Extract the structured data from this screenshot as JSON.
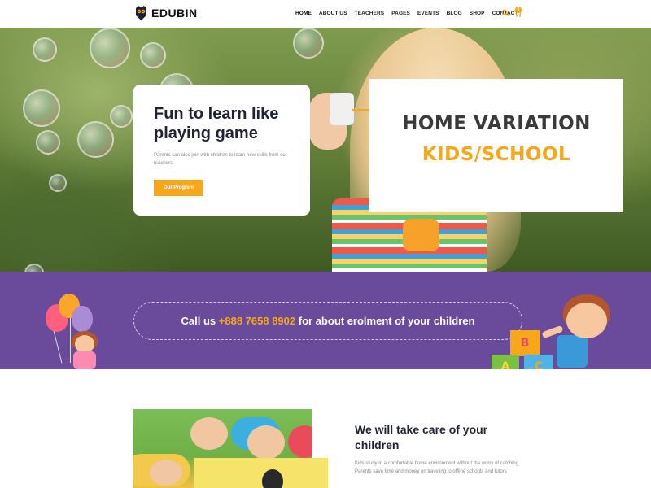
{
  "brand": {
    "name": "EDUBIN"
  },
  "nav": {
    "items": [
      "HOME",
      "ABOUT US",
      "TEACHERS",
      "PAGES",
      "EVENTS",
      "BLOG",
      "SHOP",
      "CONTACT"
    ],
    "cart_count": "0",
    "icons": [
      "search-icon",
      "cart-icon"
    ]
  },
  "hero": {
    "title": "Fun to learn like playing game",
    "text": "Parents can also join with children to learn new skills from our teachers",
    "button": "Our Program"
  },
  "variation": {
    "title": "HOME VARIATION",
    "subtitle": "KIDS/SCHOOL"
  },
  "call": {
    "prefix": "Call us",
    "phone": "+888 7658 8902",
    "suffix": "for about erolment of your children"
  },
  "blocks": [
    "B",
    "A",
    "C"
  ],
  "about": {
    "title": "We will take care of your children",
    "text": "Kids study in a comfortable home environment without the worry of catching. Parents save time and money on traveling to offline schools and tutors"
  },
  "colors": {
    "accent": "#f8a71b",
    "purple": "#6a4b9b",
    "dark": "#1f2333"
  }
}
